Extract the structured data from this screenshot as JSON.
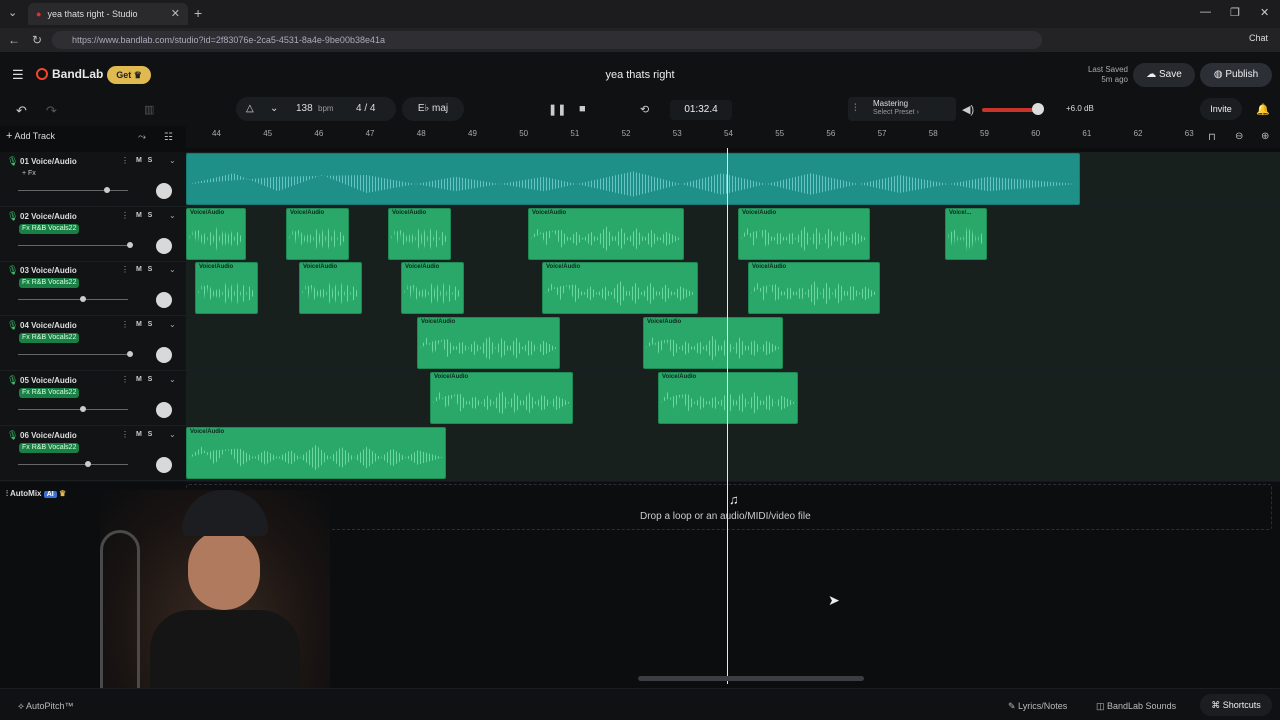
{
  "browser": {
    "tab_title": "yea thats right - Studio",
    "url": "https://www.bandlab.com/studio?id=2f83076e-2ca5-4531-8a4e-9be00b38e41a",
    "chat_label": "Chat"
  },
  "header": {
    "brand": "BandLab",
    "get_label": "Get",
    "project_title": "yea thats right",
    "last_saved_label": "Last Saved",
    "last_saved_time": "5m ago",
    "save_label": "Save",
    "publish_label": "Publish"
  },
  "transport": {
    "bpm": "138",
    "bpm_unit": "bpm",
    "time_signature": "4 / 4",
    "key": "E♭ maj",
    "time": "01:32.4",
    "mastering_label": "Mastering",
    "mastering_preset": "Select Preset ›",
    "volume_db": "+6.0 dB",
    "volume_level": 0.85,
    "invite_label": "Invite"
  },
  "toolbar": {
    "add_track_label": "Add Track"
  },
  "ruler": [
    "44",
    "45",
    "46",
    "47",
    "48",
    "49",
    "50",
    "51",
    "52",
    "53",
    "54",
    "55",
    "56",
    "57",
    "58",
    "59",
    "60",
    "61",
    "62",
    "63"
  ],
  "tracks": [
    {
      "name": "01  Voice/Audio",
      "fx": "+ Fx",
      "mute": "M",
      "solo": "S"
    },
    {
      "name": "02  Voice/Audio",
      "fx": "Fx  R&B Vocals22",
      "mute": "M",
      "solo": "S"
    },
    {
      "name": "03  Voice/Audio",
      "fx": "Fx  R&B Vocals22",
      "mute": "M",
      "solo": "S"
    },
    {
      "name": "04  Voice/Audio",
      "fx": "Fx  R&B Vocals22",
      "mute": "M",
      "solo": "S"
    },
    {
      "name": "05  Voice/Audio",
      "fx": "Fx  R&B Vocals22",
      "mute": "M",
      "solo": "S"
    },
    {
      "name": "06  Voice/Audio",
      "fx": "Fx  R&B Vocals22",
      "mute": "M",
      "solo": "S"
    }
  ],
  "clip_label": "Voice/Audio",
  "clip_label_short": "Voice/...",
  "automix_label": "AutoMix",
  "automix_badge": "AI",
  "drop_text": "Drop a loop or an audio/MIDI/video file",
  "footer": {
    "autopitch": "AutoPitch™",
    "lyrics": "Lyrics/Notes",
    "sounds": "BandLab Sounds",
    "shortcuts": "Shortcuts"
  }
}
